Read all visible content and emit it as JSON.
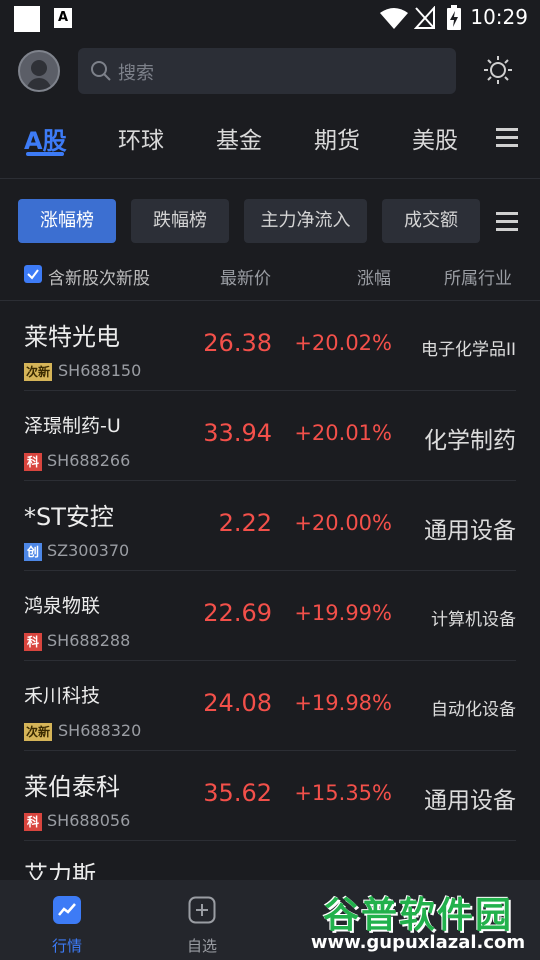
{
  "status_bar": {
    "letter_icon": "A",
    "time": "10:29"
  },
  "header": {
    "search_placeholder": "搜索"
  },
  "market_tabs": [
    "A股",
    "环球",
    "基金",
    "期货",
    "美股"
  ],
  "rank_tabs": [
    "涨幅榜",
    "跌幅榜",
    "主力净流入",
    "成交额"
  ],
  "list_header": {
    "checkbox_label": "含新股次新股",
    "col_price": "最新价",
    "col_change": "涨幅",
    "col_industry": "所属行业"
  },
  "stocks": [
    {
      "name": "莱特光电",
      "tag": "次新",
      "code": "SH688150",
      "price": "26.38",
      "change": "+20.02%",
      "industry": "电子化学品II"
    },
    {
      "name": "泽璟制药-U",
      "tag": "科",
      "code": "SH688266",
      "price": "33.94",
      "change": "+20.01%",
      "industry": "化学制药"
    },
    {
      "name": "*ST安控",
      "tag": "创",
      "code": "SZ300370",
      "price": "2.22",
      "change": "+20.00%",
      "industry": "通用设备"
    },
    {
      "name": "鸿泉物联",
      "tag": "科",
      "code": "SH688288",
      "price": "22.69",
      "change": "+19.99%",
      "industry": "计算机设备"
    },
    {
      "name": "禾川科技",
      "tag": "次新",
      "code": "SH688320",
      "price": "24.08",
      "change": "+19.98%",
      "industry": "自动化设备"
    },
    {
      "name": "莱伯泰科",
      "tag": "科",
      "code": "SH688056",
      "price": "35.62",
      "change": "+15.35%",
      "industry": "通用设备"
    },
    {
      "name": "艾力斯",
      "tag": "",
      "code": "",
      "price": "",
      "change": "",
      "industry": ""
    }
  ],
  "bottom_nav": [
    "行情",
    "自选"
  ],
  "watermark": {
    "title": "谷普软件园",
    "url": "www.gupuxlazal.com"
  },
  "colors": {
    "accent": "#3d7bf6",
    "up": "#f3504a",
    "background": "#1b1c20"
  }
}
